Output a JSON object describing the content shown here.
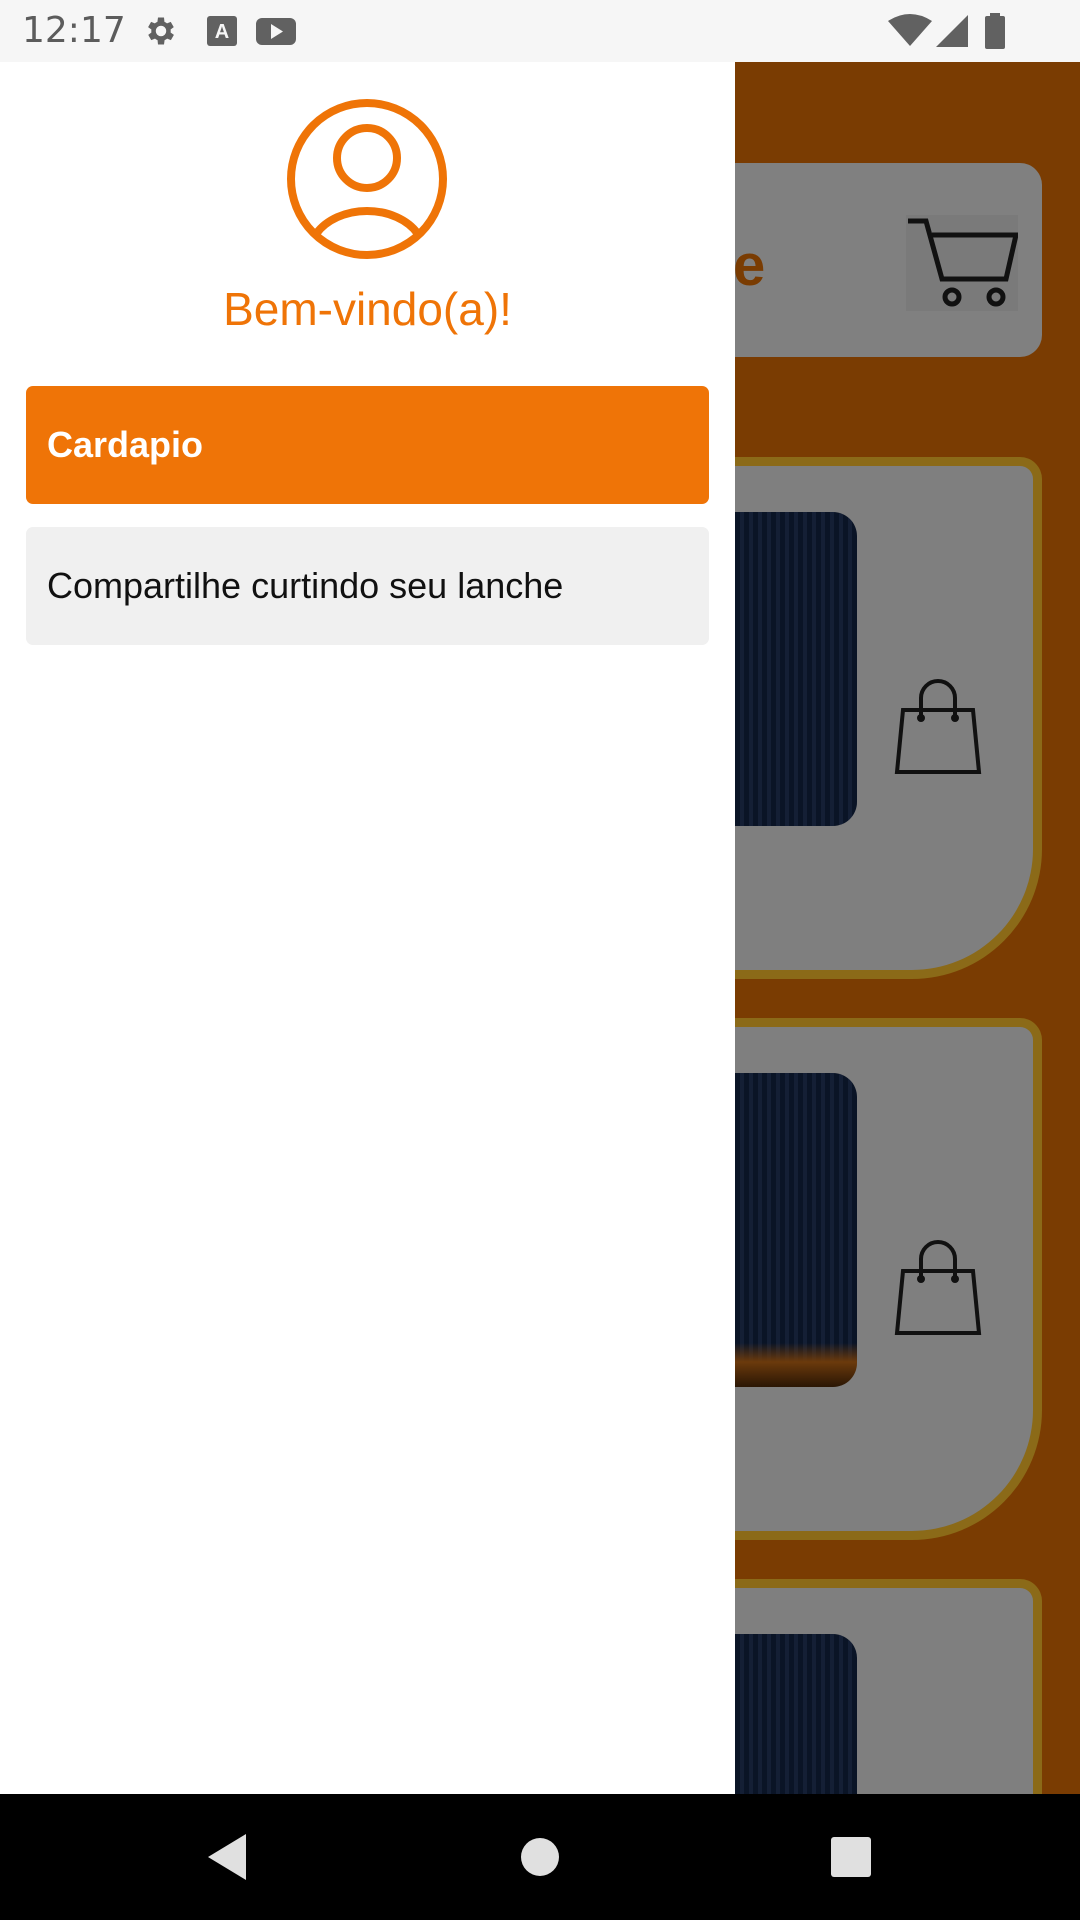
{
  "status_bar": {
    "time": "12:17",
    "icons": [
      "gear-icon",
      "text-input-icon",
      "youtube-icon",
      "wifi-icon",
      "signal-icon",
      "battery-icon"
    ]
  },
  "background_app": {
    "title_fragment": "e",
    "icons": [
      "cart-icon",
      "shopping-bag-icon"
    ]
  },
  "drawer": {
    "avatar_icon": "user-circle-icon",
    "welcome": "Bem-vindo(a)!",
    "items": [
      {
        "label": "Cardapio",
        "active": true
      },
      {
        "label": "Compartilhe curtindo seu lanche",
        "active": false
      }
    ]
  },
  "navigation_bar": {
    "buttons": [
      "back-icon",
      "home-icon",
      "recents-icon"
    ]
  },
  "colors": {
    "accent": "#ef7407",
    "app_background": "#7a3c02",
    "menu_inactive_bg": "#f0f0f0"
  }
}
